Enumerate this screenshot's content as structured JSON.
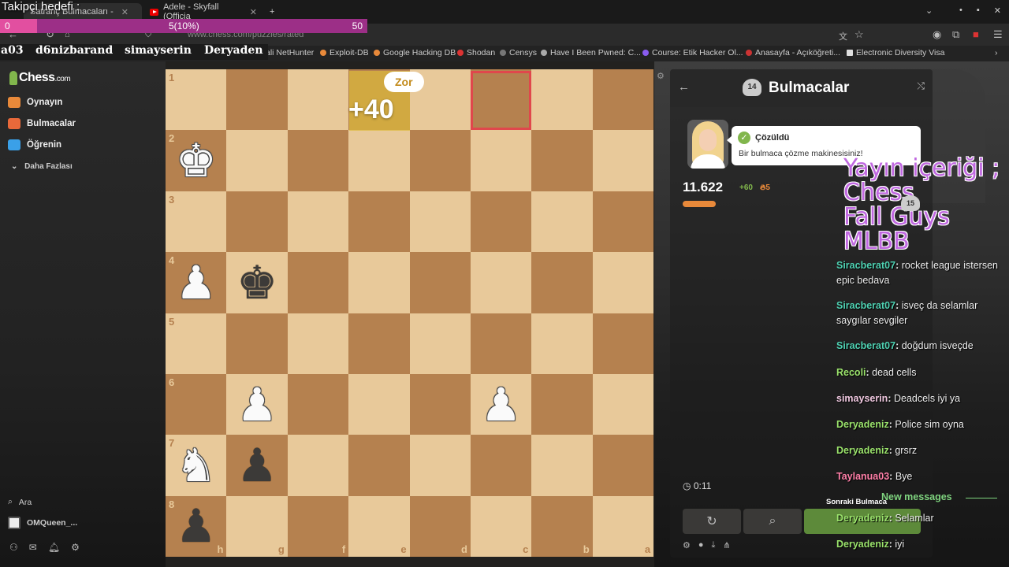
{
  "browser": {
    "tabs": [
      {
        "label": "Satranç Bulmacaları -",
        "active": true
      },
      {
        "label": "Adele - Skyfall (Officia",
        "active": false
      }
    ],
    "url": "www.chess.com/puzzles/rated",
    "bookmarks": [
      "Kali NetHunter",
      "Exploit-DB",
      "Google Hacking DB",
      "Shodan",
      "Censys",
      "Have I Been Pwned: C...",
      "Course: Etik Hacker Ol...",
      "Anasayfa - Açıköğreti...",
      "Electronic Diversity Visa"
    ]
  },
  "overlay": {
    "follower_goal_title": "Takipçi hedefi :",
    "goal_min": "0",
    "goal_progress_label": "5(10%)",
    "goal_max": "50",
    "goal_fraction": 0.1,
    "names": [
      "a03",
      "d6nizbarand",
      "simayserin",
      "Deryaden"
    ],
    "stream_content_lines": [
      "Yayın içeriği ;",
      "Chess",
      "Fall Guys",
      "MLBB"
    ],
    "badge_15": "15"
  },
  "sidebar": {
    "logo": "Chess",
    "logo_suffix": ".com",
    "items": [
      {
        "label": "Oynayın",
        "icon": "pawn-play-icon",
        "color": "#e8893a"
      },
      {
        "label": "Bulmacalar",
        "icon": "puzzle-piece-icon",
        "color": "#e8693a"
      },
      {
        "label": "Öğrenin",
        "icon": "graduation-cap-icon",
        "color": "#3aa0e8"
      }
    ],
    "more": "Daha Fazlası",
    "search": "Ara",
    "user": "OMQueen_..."
  },
  "board": {
    "ranks": [
      "1",
      "2",
      "3",
      "4",
      "5",
      "6",
      "7",
      "8"
    ],
    "files": [
      "h",
      "g",
      "f",
      "e",
      "d",
      "c",
      "b",
      "a"
    ],
    "difficulty": "Zor",
    "points": "+40",
    "pieces": [
      {
        "sq": "1,0",
        "glyph": "♚",
        "color": "w",
        "name": "white-king-piece"
      },
      {
        "sq": "3,0",
        "glyph": "♟",
        "color": "w",
        "name": "white-pawn-piece"
      },
      {
        "sq": "3,1",
        "glyph": "♚",
        "color": "b",
        "name": "black-king-piece"
      },
      {
        "sq": "5,1",
        "glyph": "♟",
        "color": "w",
        "name": "white-pawn-piece"
      },
      {
        "sq": "5,5",
        "glyph": "♟",
        "color": "w",
        "name": "white-pawn-piece"
      },
      {
        "sq": "6,0",
        "glyph": "♞",
        "color": "w",
        "name": "white-knight-piece"
      },
      {
        "sq": "6,1",
        "glyph": "♟",
        "color": "b",
        "name": "black-pawn-piece"
      },
      {
        "sq": "7,0",
        "glyph": "♟",
        "color": "b",
        "name": "black-pawn-piece"
      }
    ]
  },
  "panel": {
    "title": "Bulmacalar",
    "badge": "14",
    "solved_title": "Çözüldü",
    "solved_text": "Bir bulmaca çözme makinesisiniz!",
    "rating": "11.622",
    "rating_delta": "+60",
    "streak": "5",
    "timer": "0:11",
    "next_tooltip": "Sonraki Bulmaca"
  },
  "chat": {
    "new_messages": "New messages",
    "messages": [
      {
        "user": "Siracberat07",
        "text": "rocket league istersen epic bedava",
        "color": "#4ed1b2"
      },
      {
        "user": "Siracberat07",
        "text": "isveç da selamlar saygılar sevgiler",
        "color": "#4ed1b2"
      },
      {
        "user": "Siracberat07",
        "text": "doğdum isveçde",
        "color": "#4ed1b2"
      },
      {
        "user": "Recoli",
        "text": "dead cells",
        "color": "#9be36c"
      },
      {
        "user": "simayserin",
        "text": "Deadcels iyi ya",
        "color": "#f0c8e0"
      },
      {
        "user": "Deryadeniz",
        "text": "Police sim oyna",
        "color": "#9be36c"
      },
      {
        "user": "Deryadeniz",
        "text": "grsrz",
        "color": "#9be36c"
      },
      {
        "user": "Taylanua03",
        "text": "Bye",
        "color": "#ff7fa8"
      },
      {
        "user": "Deryadeniz",
        "text": "Selamlar",
        "color": "#9be36c"
      },
      {
        "user": "Deryadeniz",
        "text": "iyi",
        "color": "#9be36c"
      }
    ]
  }
}
